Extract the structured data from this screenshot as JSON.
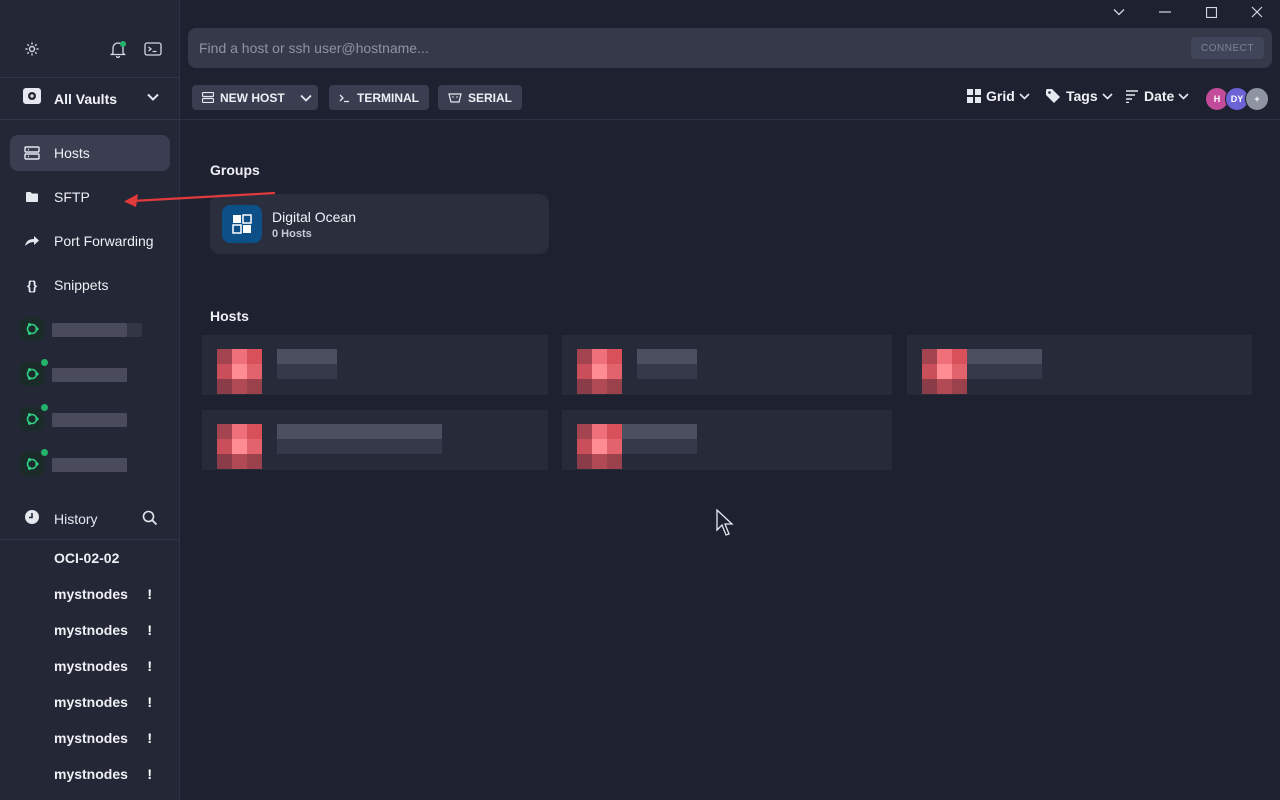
{
  "window": {
    "controls": [
      "minimize",
      "restore",
      "maximize",
      "close"
    ]
  },
  "sidebar": {
    "vault": {
      "label": "All Vaults"
    },
    "nav": [
      {
        "label": "Hosts",
        "icon": "hosts-icon",
        "active": true
      },
      {
        "label": "SFTP",
        "icon": "folder-icon",
        "active": false
      },
      {
        "label": "Port Forwarding",
        "icon": "port-forward-icon",
        "active": false
      },
      {
        "label": "Snippets",
        "icon": "braces-icon",
        "active": false
      }
    ],
    "history_label": "History",
    "history": [
      {
        "label": "OCI-02-02",
        "warn": ""
      },
      {
        "label": "mystnodes",
        "warn": "!"
      },
      {
        "label": "mystnodes",
        "warn": "!"
      },
      {
        "label": "mystnodes",
        "warn": "!"
      },
      {
        "label": "mystnodes",
        "warn": "!"
      },
      {
        "label": "mystnodes",
        "warn": "!"
      },
      {
        "label": "mystnodes",
        "warn": "!"
      }
    ]
  },
  "search": {
    "placeholder": "Find a host or ssh user@hostname...",
    "connect_label": "CONNECT"
  },
  "toolbar": {
    "new_host": "NEW HOST",
    "terminal": "TERMINAL",
    "serial": "SERIAL",
    "view": "Grid",
    "tags": "Tags",
    "sort": "Date",
    "avatars": [
      {
        "initials": "H",
        "color": "#c24b9a"
      },
      {
        "initials": "DY",
        "color": "#6b63d6"
      },
      {
        "initials": "+",
        "color": "#8f94a3"
      }
    ]
  },
  "main": {
    "groups_title": "Groups",
    "group": {
      "name": "Digital Ocean",
      "count": "0 Hosts"
    },
    "hosts_title": "Hosts"
  },
  "colors": {
    "accent_green": "#24b36b",
    "ubuntu_green": "#2fcf86",
    "annotation_red": "#e03a3a"
  }
}
